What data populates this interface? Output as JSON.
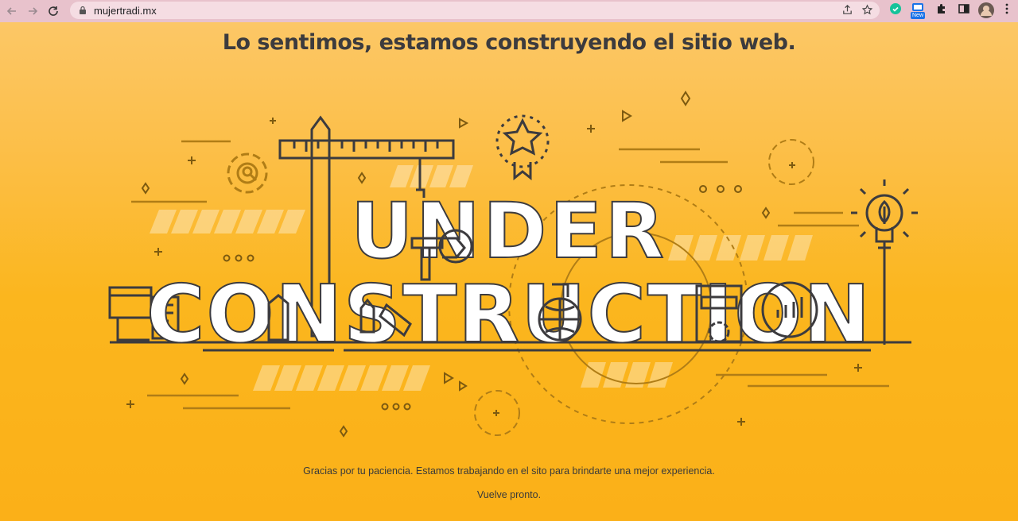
{
  "browser": {
    "url": "mujertradi.mx",
    "new_badge": "New"
  },
  "page": {
    "headline": "Lo sentimos, estamos construyendo el sitio web.",
    "art_word_1": "UNDER",
    "art_word_2": "CONSTRUCTION",
    "message_1": "Gracias por tu paciencia. Estamos trabajando en el sito para brindarte una mejor experiencia.",
    "message_2": "Vuelve pronto."
  },
  "colors": {
    "background": "#fbb417",
    "line_art": "#3c3b3e",
    "accent_line": "#b07d16",
    "chrome": "#e8c2cc"
  }
}
